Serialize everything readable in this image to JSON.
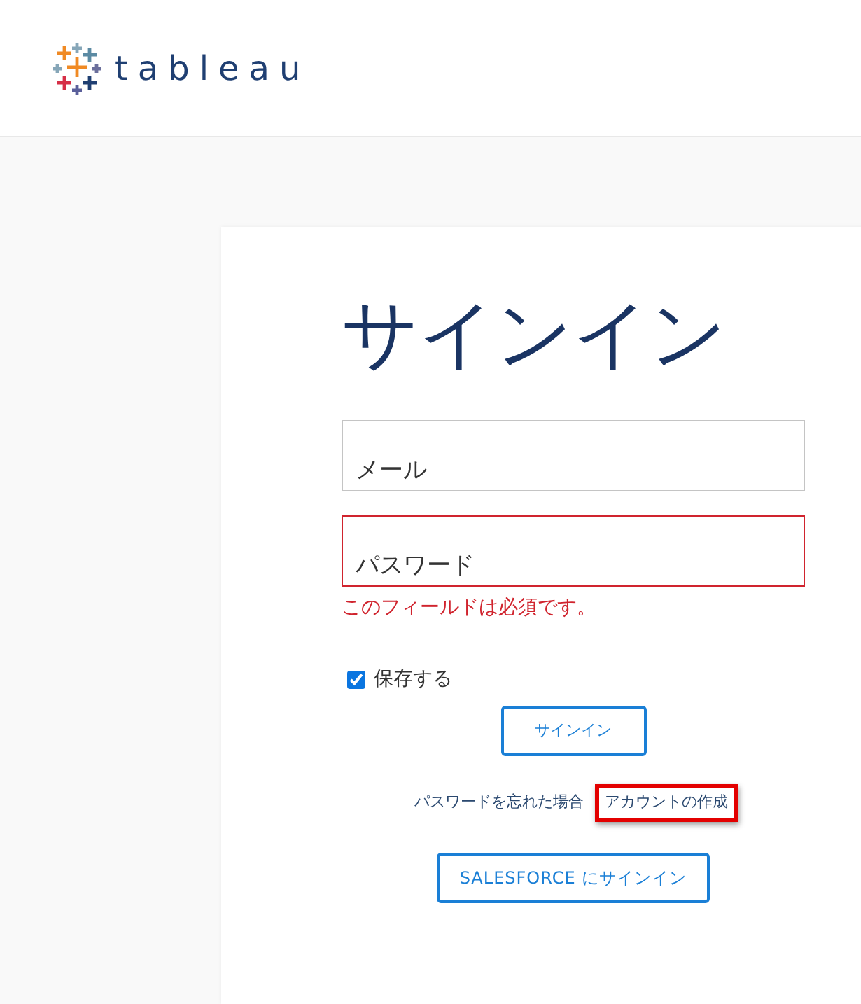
{
  "header": {
    "logo_text": "tableau"
  },
  "form": {
    "title": "サインイン",
    "fields": [
      {
        "placeholder": "メール",
        "invalid": false
      },
      {
        "placeholder": "パスワード",
        "invalid": true,
        "error": "このフィールドは必須です。"
      }
    ],
    "remember": {
      "label": "保存する",
      "checked": true
    },
    "submit": "サインイン",
    "links": [
      {
        "text": "パスワードを忘れた場合",
        "highlighted": false
      },
      {
        "text": "アカウントの作成",
        "highlighted": true
      }
    ],
    "sso_button": "SALESFORCE にサインイン"
  }
}
